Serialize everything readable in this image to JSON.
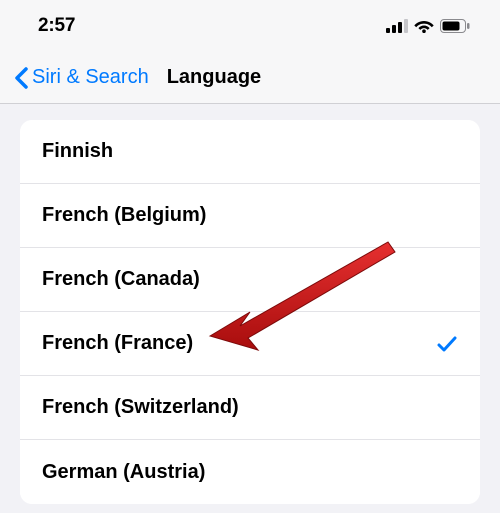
{
  "status": {
    "time": "2:57"
  },
  "nav": {
    "back_label": "Siri & Search",
    "title": "Language"
  },
  "languages": {
    "items": [
      {
        "label": "Finnish",
        "selected": false
      },
      {
        "label": "French (Belgium)",
        "selected": false
      },
      {
        "label": "French (Canada)",
        "selected": false
      },
      {
        "label": "French (France)",
        "selected": true
      },
      {
        "label": "French (Switzerland)",
        "selected": false
      },
      {
        "label": "German (Austria)",
        "selected": false
      }
    ]
  },
  "colors": {
    "accent": "#007aff",
    "arrow": "#c91818"
  }
}
